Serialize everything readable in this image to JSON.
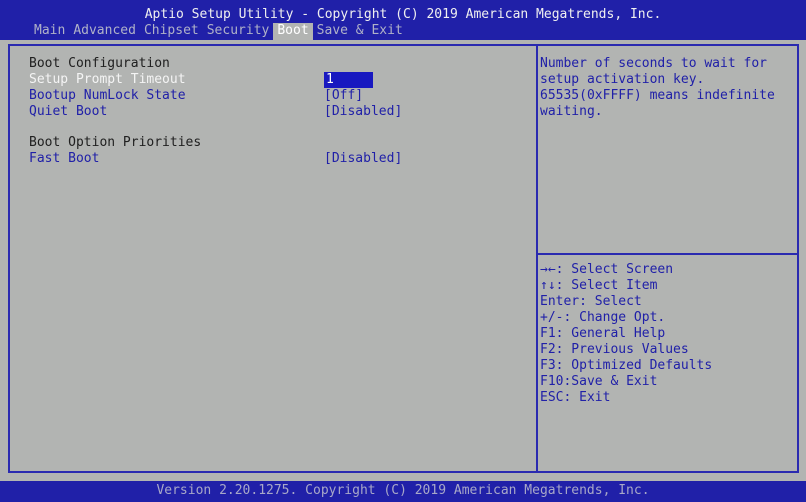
{
  "header": {
    "title": "Aptio Setup Utility - Copyright (C) 2019 American Megatrends, Inc.",
    "tabs": [
      "Main",
      "Advanced",
      "Chipset",
      "Security",
      "Boot",
      "Save & Exit"
    ],
    "active_tab": "Boot"
  },
  "main": {
    "section1": "Boot Configuration",
    "items1": [
      {
        "label": "Setup Prompt Timeout",
        "value": "1"
      },
      {
        "label": "Bootup NumLock State",
        "value": "[Off]"
      },
      {
        "label": "Quiet Boot",
        "value": "[Disabled]"
      }
    ],
    "section2": "Boot Option Priorities",
    "items2": [
      {
        "label": "Fast Boot",
        "value": "[Disabled]"
      }
    ]
  },
  "help": {
    "description": [
      "Number of seconds to wait for",
      "setup activation key.",
      "65535(0xFFFF) means indefinite",
      "waiting."
    ],
    "keys": [
      "→←: Select Screen",
      "↑↓: Select Item",
      "Enter: Select",
      "+/-: Change Opt.",
      "F1: General Help",
      "F2: Previous Values",
      "F3: Optimized Defaults",
      "F10:Save & Exit",
      "ESC: Exit"
    ]
  },
  "footer": "Version 2.20.1275. Copyright (C) 2019 American Megatrends, Inc.",
  "colors": {
    "blue": "#2020a8",
    "gray": "#b2b4b2"
  }
}
